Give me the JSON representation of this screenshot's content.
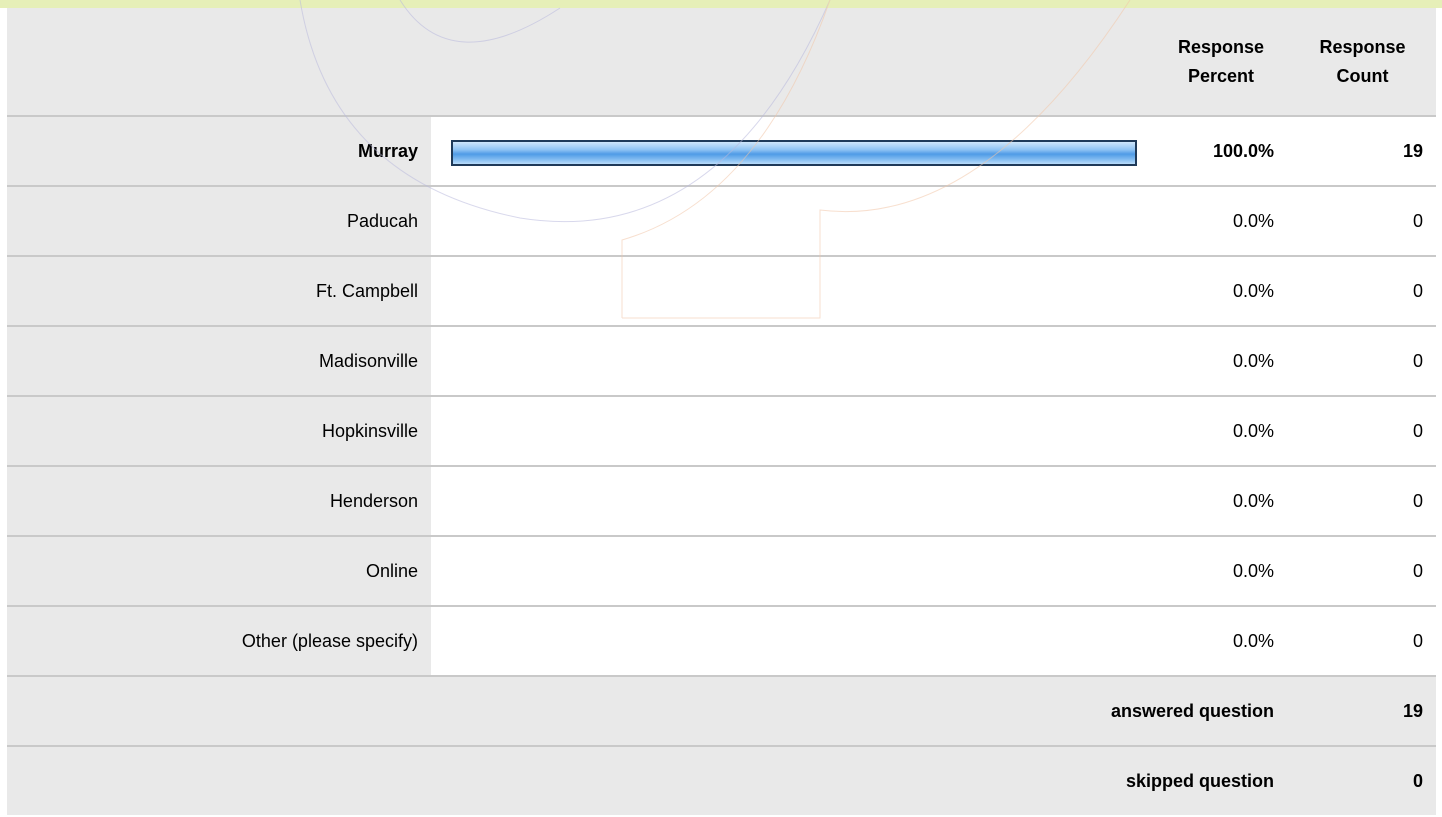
{
  "header": {
    "percent_label": "Response\nPercent",
    "count_label": "Response\nCount"
  },
  "chart_data": {
    "type": "table",
    "columns": [
      "Response Percent",
      "Response Count"
    ],
    "categories": [
      "Murray",
      "Paducah",
      "Ft. Campbell",
      "Madisonville",
      "Hopkinsville",
      "Henderson",
      "Online",
      "Other (please specify)"
    ],
    "percent_labels": [
      "100.0%",
      "0.0%",
      "0.0%",
      "0.0%",
      "0.0%",
      "0.0%",
      "0.0%",
      "0.0%"
    ],
    "percent_values": [
      100.0,
      0.0,
      0.0,
      0.0,
      0.0,
      0.0,
      0.0,
      0.0
    ],
    "counts": [
      "19",
      "0",
      "0",
      "0",
      "0",
      "0",
      "0",
      "0"
    ],
    "bold_row": "Murray",
    "bar_color": "#4f9be6",
    "bar_border_color": "#1f3a59"
  },
  "summary": {
    "answered_label": "answered question",
    "answered_count": "19",
    "skipped_label": "skipped question",
    "skipped_count": "0"
  }
}
